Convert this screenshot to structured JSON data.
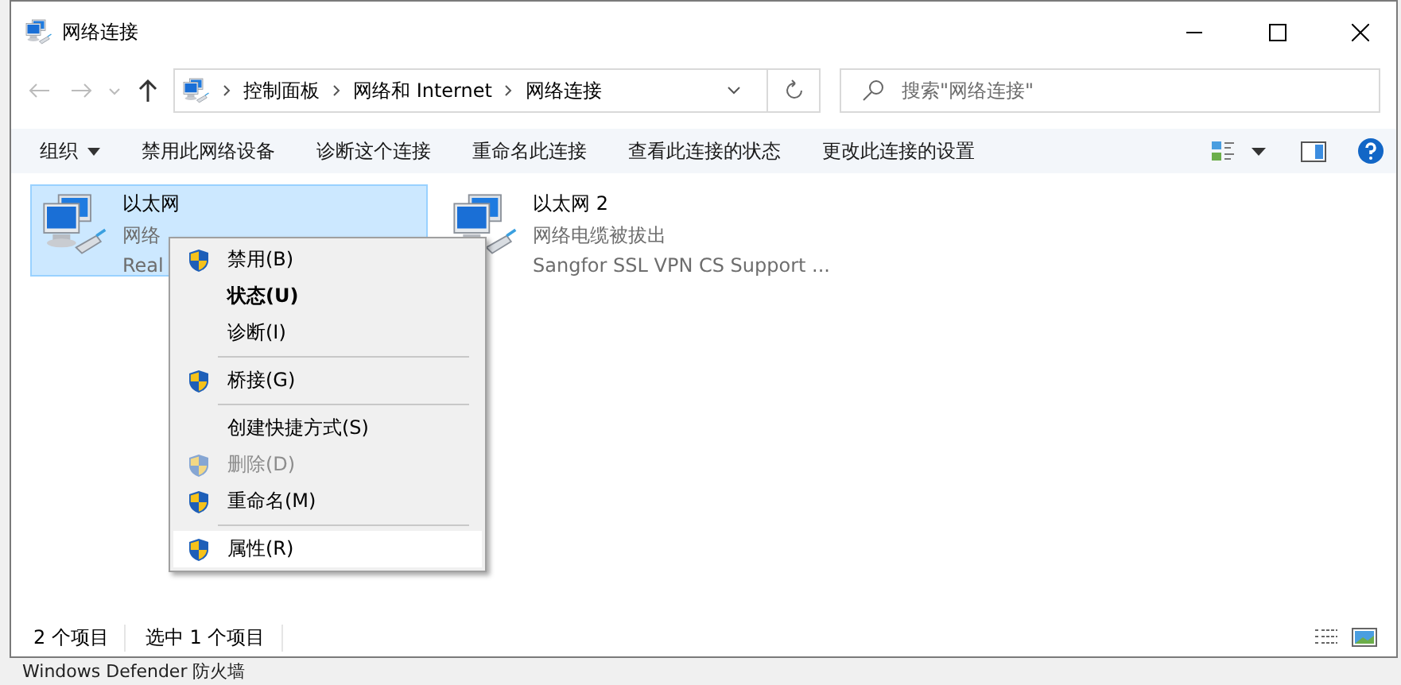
{
  "window": {
    "title": "网络连接"
  },
  "address_bar": {
    "breadcrumbs": [
      "控制面板",
      "网络和 Internet",
      "网络连接"
    ]
  },
  "search": {
    "placeholder": "搜索\"网络连接\""
  },
  "toolbar": {
    "items": [
      {
        "label": "组织",
        "dropdown": true
      },
      {
        "label": "禁用此网络设备",
        "dropdown": false
      },
      {
        "label": "诊断这个连接",
        "dropdown": false
      },
      {
        "label": "重命名此连接",
        "dropdown": false
      },
      {
        "label": "查看此连接的状态",
        "dropdown": false
      },
      {
        "label": "更改此连接的设置",
        "dropdown": false
      }
    ]
  },
  "connections": [
    {
      "name": "以太网",
      "status": "网络",
      "device": "Real",
      "selected": true
    },
    {
      "name": "以太网 2",
      "status": "网络电缆被拔出",
      "device": "Sangfor SSL VPN CS Support ...",
      "selected": false
    }
  ],
  "context_menu": {
    "groups": [
      [
        {
          "label": "禁用(B)",
          "shield": true,
          "default": false,
          "disabled": false,
          "selected": false
        },
        {
          "label": "状态(U)",
          "shield": false,
          "default": true,
          "disabled": false,
          "selected": false
        },
        {
          "label": "诊断(I)",
          "shield": false,
          "default": false,
          "disabled": false,
          "selected": false
        }
      ],
      [
        {
          "label": "桥接(G)",
          "shield": true,
          "default": false,
          "disabled": false,
          "selected": false
        }
      ],
      [
        {
          "label": "创建快捷方式(S)",
          "shield": false,
          "default": false,
          "disabled": false,
          "selected": false
        },
        {
          "label": "删除(D)",
          "shield": true,
          "default": false,
          "disabled": true,
          "selected": false
        },
        {
          "label": "重命名(M)",
          "shield": true,
          "default": false,
          "disabled": false,
          "selected": false
        }
      ],
      [
        {
          "label": "属性(R)",
          "shield": true,
          "default": false,
          "disabled": false,
          "selected": true
        }
      ]
    ]
  },
  "status_bar": {
    "items": [
      "2 个项目",
      "选中 1 个项目"
    ]
  },
  "background_text": "Windows Defender 防火墙"
}
